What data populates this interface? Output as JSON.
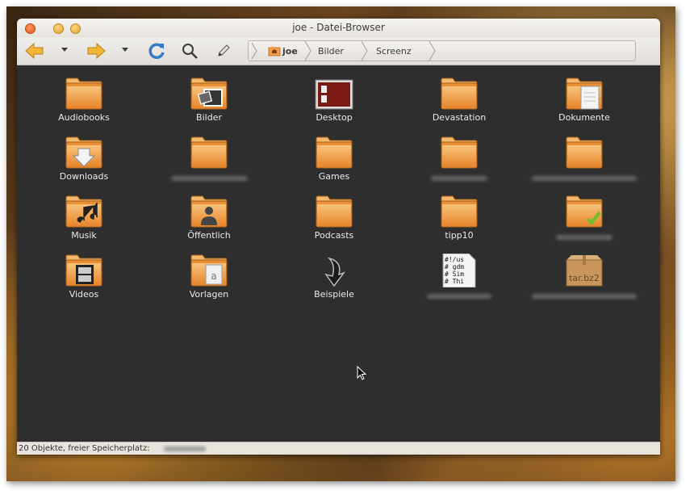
{
  "window": {
    "title": "joe - Datei-Browser"
  },
  "toolbar": {
    "back_icon": "back-arrow-icon",
    "forward_icon": "forward-arrow-icon",
    "reload_icon": "reload-icon",
    "search_icon": "search-icon",
    "edit_icon": "pencil-icon"
  },
  "pathbar": {
    "crumbs": [
      {
        "label": "joe",
        "icon": "home-folder-icon"
      },
      {
        "label": "Bilder"
      },
      {
        "label": "Screenz"
      }
    ]
  },
  "files": [
    {
      "label": "Audiobooks",
      "icon": "folder"
    },
    {
      "label": "Bilder",
      "icon": "folder-pictures"
    },
    {
      "label": "Desktop",
      "icon": "desktop"
    },
    {
      "label": "Devastation",
      "icon": "folder"
    },
    {
      "label": "Dokumente",
      "icon": "folder-documents"
    },
    {
      "label": "Downloads",
      "icon": "folder-download"
    },
    {
      "label": "",
      "icon": "folder",
      "hidden_label": true
    },
    {
      "label": "Games",
      "icon": "folder"
    },
    {
      "label": "",
      "icon": "folder",
      "hidden_label": true
    },
    {
      "label": "",
      "icon": "folder",
      "hidden_label": true
    },
    {
      "label": "Musik",
      "icon": "folder-music"
    },
    {
      "label": "Öffentlich",
      "icon": "folder-public"
    },
    {
      "label": "Podcasts",
      "icon": "folder"
    },
    {
      "label": "tipp10",
      "icon": "folder"
    },
    {
      "label": "",
      "icon": "folder-check",
      "hidden_label": true
    },
    {
      "label": "Videos",
      "icon": "folder-videos"
    },
    {
      "label": "Vorlagen",
      "icon": "folder-templates"
    },
    {
      "label": "Beispiele",
      "icon": "symlink"
    },
    {
      "label": "",
      "icon": "script-file",
      "hidden_label": true,
      "preview_lines": [
        "#!/us",
        "# gdm",
        "# Sim",
        "# Thi"
      ]
    },
    {
      "label": "",
      "icon": "archive",
      "hidden_label": true,
      "badge": "tar.bz2"
    }
  ],
  "statusbar": {
    "text": "20 Objekte, freier Speicherplatz:"
  },
  "colors": {
    "folder": "#f0a04a",
    "folder_light": "#f7c27a",
    "background": "#2e2e2e",
    "accent": "#e0541b"
  }
}
